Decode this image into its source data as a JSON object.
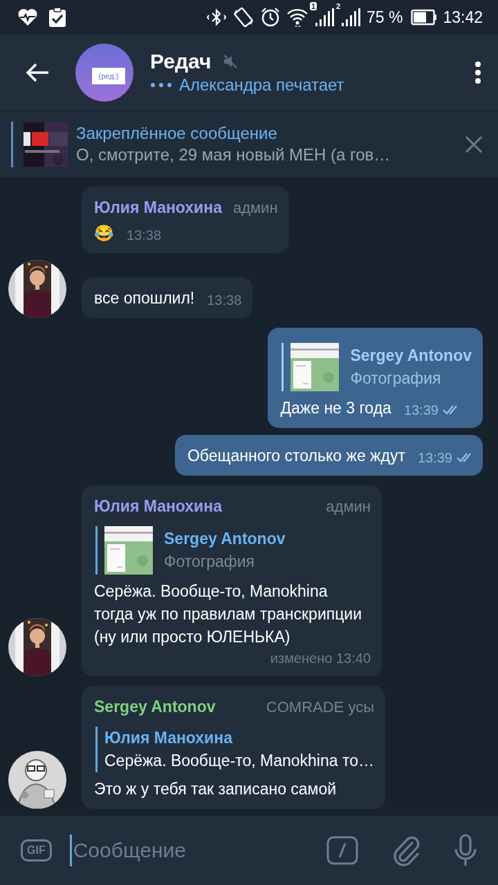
{
  "status_bar": {
    "sim_1": "1",
    "sim_2": "2",
    "battery": "75 %",
    "time": "13:42"
  },
  "header": {
    "title": "Редач",
    "muted": true,
    "avatar_label": "(ред.)",
    "typing_status": "Александра печатает"
  },
  "pinned": {
    "title": "Закреплённое сообщение",
    "text": "О, смотрите, 29 мая новый МЕН (а гов…"
  },
  "messages": [
    {
      "kind": "incoming",
      "sender": "Юлия Манохина",
      "color": "#9b9cf0",
      "badge": "админ",
      "avatar": false,
      "text": "😂",
      "time": "13:38"
    },
    {
      "kind": "incoming",
      "avatar": true,
      "text": "все опошлил!",
      "time": "13:38"
    },
    {
      "kind": "outgoing",
      "reply": {
        "name": "Sergey Antonov",
        "text": "Фотография"
      },
      "text": "Даже не 3 года",
      "time": "13:39",
      "read": true
    },
    {
      "kind": "outgoing",
      "text": "Обещанного столько же ждут",
      "time": "13:39",
      "read": true
    },
    {
      "kind": "incoming",
      "sender": "Юлия Манохина",
      "color": "#9b9cf0",
      "badge": "админ",
      "avatar": true,
      "reply": {
        "name": "Sergey Antonov",
        "text": "Фотография"
      },
      "text": "Серёжа. Вообще-то, Manokhina тогда уж по правилам транскрипции (ну или просто ЮЛЕНЬКА)",
      "time": "изменено 13:40"
    },
    {
      "kind": "incoming",
      "sender": "Sergey Antonov",
      "color": "#7fd17f",
      "badge": "COMRADE усы",
      "avatar": true,
      "reply": {
        "kind": "text",
        "name": "Юлия Манохина",
        "text": "Серёжа. Вообще-то, Manokhina то…"
      },
      "text": "Это ж у тебя так записано самой"
    }
  ],
  "composer": {
    "gif_label": "GIF",
    "placeholder": "Сообщение"
  }
}
